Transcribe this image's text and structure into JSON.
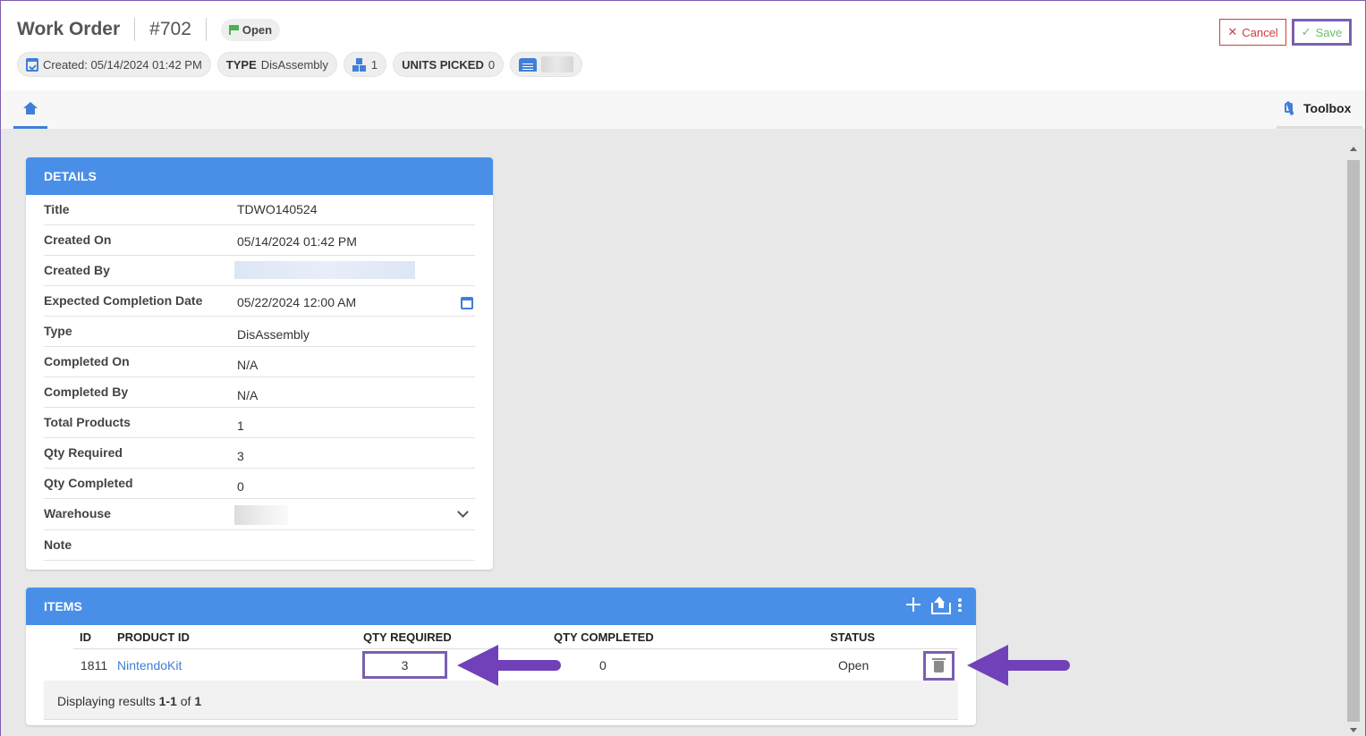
{
  "header": {
    "title": "Work Order",
    "number": "#702",
    "status": "Open",
    "created_chip": "Created: 05/14/2024 01:42 PM",
    "type_label": "TYPE",
    "type_value": "DisAssembly",
    "products_count": "1",
    "units_picked_label": "UNITS PICKED",
    "units_picked_value": "0",
    "cancel_label": "Cancel",
    "save_label": "Save"
  },
  "tabs": {
    "toolbox_label": "Toolbox"
  },
  "details": {
    "heading": "DETAILS",
    "rows": [
      {
        "label": "Title",
        "value": "TDWO140524"
      },
      {
        "label": "Created On",
        "value": "05/14/2024 01:42 PM"
      },
      {
        "label": "Created By",
        "value": ""
      },
      {
        "label": "Expected Completion Date",
        "value": "05/22/2024 12:00 AM"
      },
      {
        "label": "Type",
        "value": "DisAssembly"
      },
      {
        "label": "Completed On",
        "value": "N/A"
      },
      {
        "label": "Completed By",
        "value": "N/A"
      },
      {
        "label": "Total Products",
        "value": "1"
      },
      {
        "label": "Qty Required",
        "value": "3"
      },
      {
        "label": "Qty Completed",
        "value": "0"
      },
      {
        "label": "Warehouse",
        "value": ""
      },
      {
        "label": "Note",
        "value": ""
      }
    ]
  },
  "items": {
    "heading": "ITEMS",
    "columns": {
      "id": "ID",
      "product_id": "PRODUCT ID",
      "qty_required": "QTY REQUIRED",
      "qty_completed": "QTY COMPLETED",
      "status": "STATUS"
    },
    "rows": [
      {
        "id": "1811",
        "product_id": "NintendoKit",
        "qty_required": "3",
        "qty_completed": "0",
        "status": "Open"
      }
    ],
    "footer": {
      "prefix": "Displaying results",
      "range": "1-1",
      "of": "of",
      "total": "1"
    }
  },
  "colors": {
    "accent": "#4a8fe7",
    "annotation": "#7b5fb0",
    "cancel": "#d23b3b",
    "save": "#6cbf6c"
  }
}
